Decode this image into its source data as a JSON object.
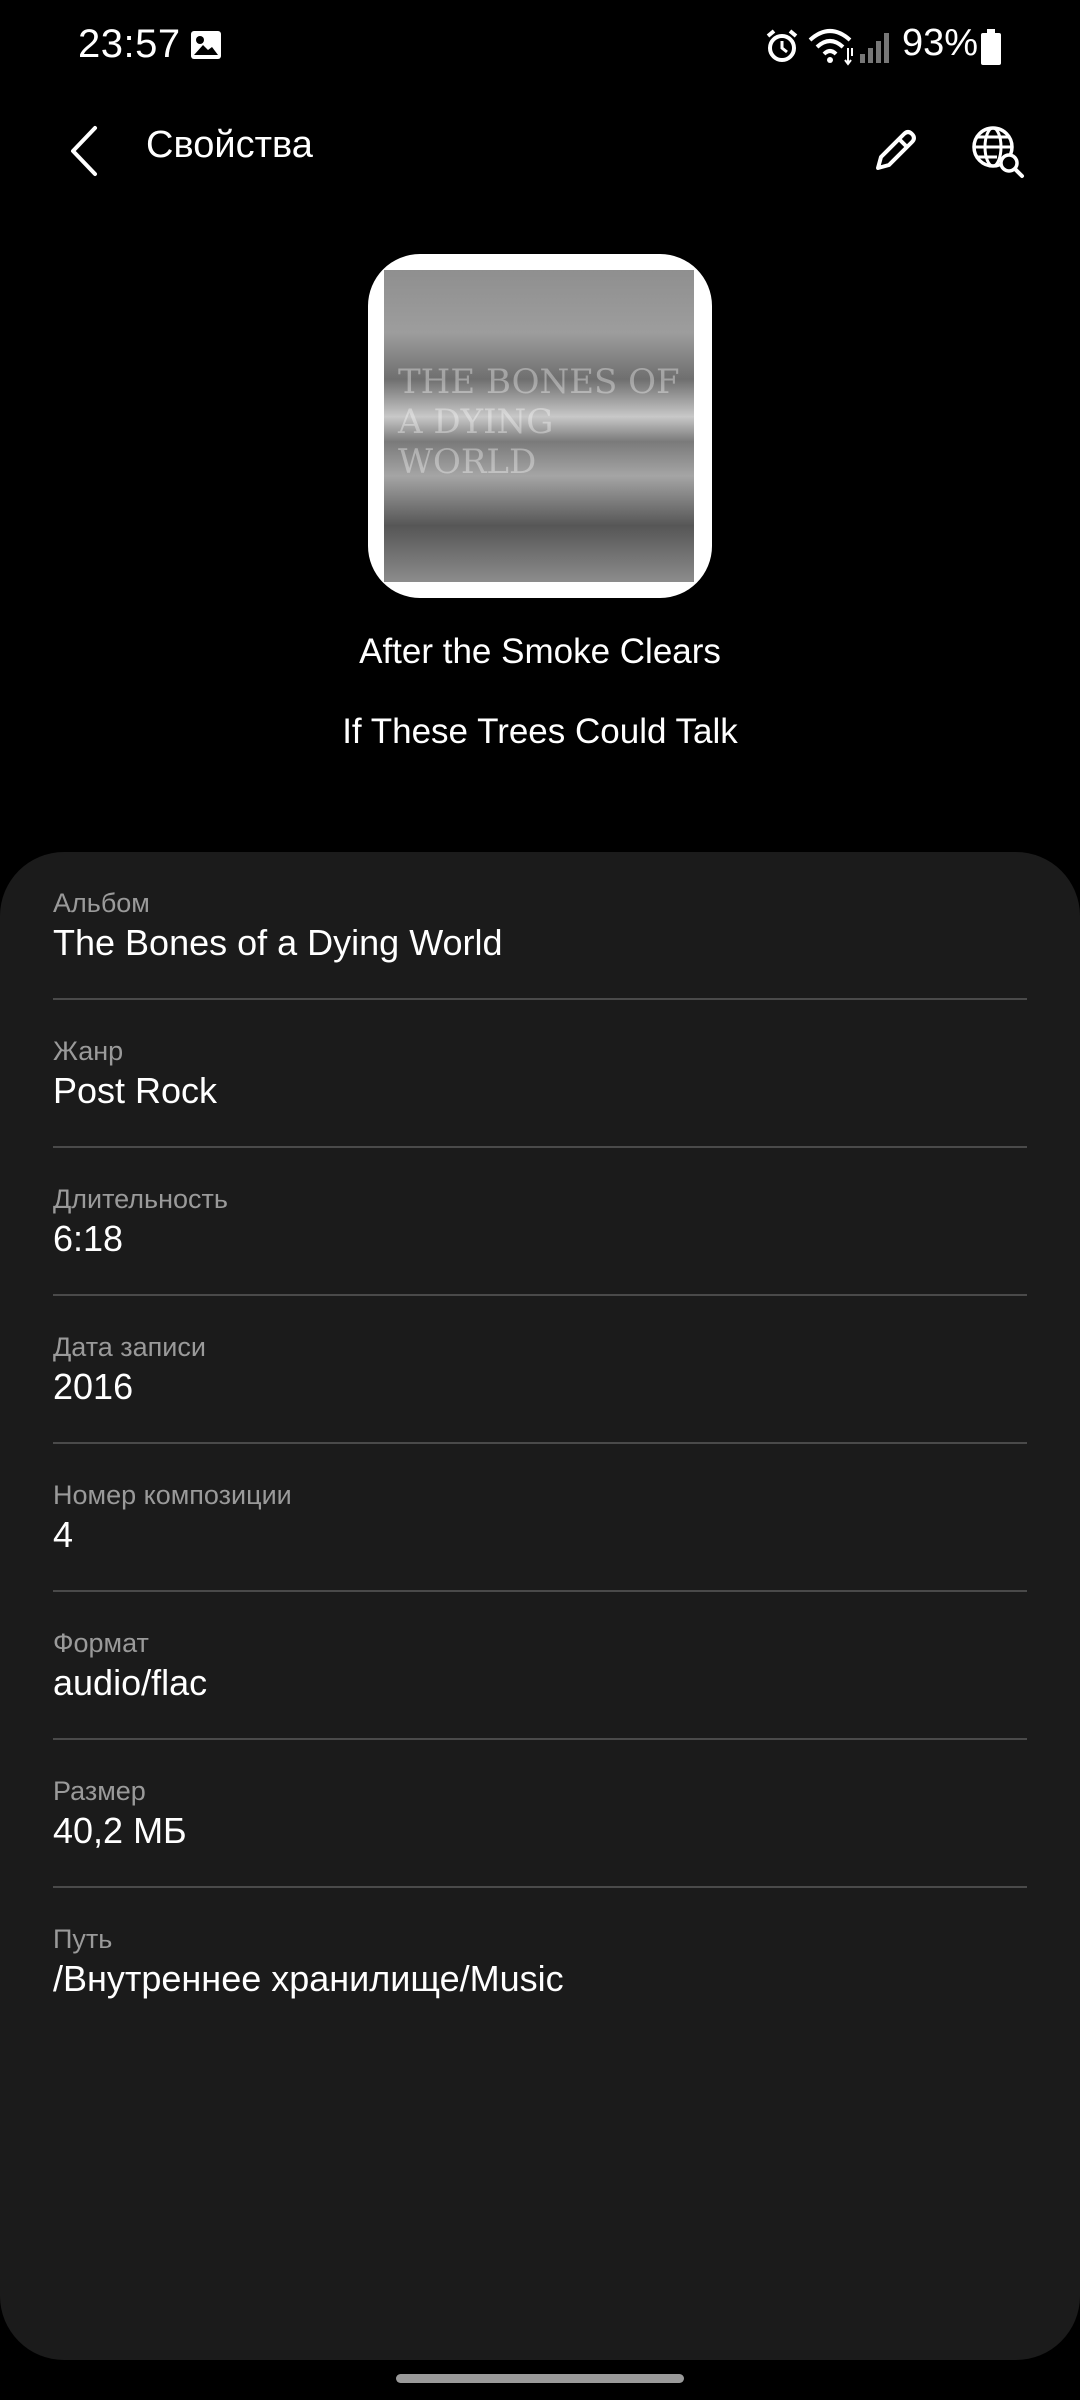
{
  "status_bar": {
    "time": "23:57",
    "battery": "93%",
    "icons": [
      "gallery-icon",
      "alarm-icon",
      "wifi-icon",
      "signal-icon",
      "battery-icon"
    ]
  },
  "app_bar": {
    "title": "Свойства",
    "icons": [
      "back-arrow-icon",
      "edit-pencil-icon",
      "globe-search-icon"
    ]
  },
  "album_art": {
    "overlay_text": "The Bones of a Dying World"
  },
  "track": {
    "title": "After the Smoke Clears",
    "artist": "If These Trees Could Talk"
  },
  "details": [
    {
      "label": "Альбом",
      "value": "The Bones of a Dying World"
    },
    {
      "label": "Жанр",
      "value": "Post Rock"
    },
    {
      "label": "Длительность",
      "value": "6:18"
    },
    {
      "label": "Дата записи",
      "value": "2016"
    },
    {
      "label": "Номер композиции",
      "value": "4"
    },
    {
      "label": "Формат",
      "value": "audio/flac"
    },
    {
      "label": "Размер",
      "value": "40,2 МБ"
    },
    {
      "label": "Путь",
      "value": "/Внутреннее хранилище/Music"
    }
  ],
  "colors": {
    "background": "#000000",
    "card": "#1b1b1b",
    "label": "#9a9a9a",
    "divider": "#4a4a4a"
  }
}
